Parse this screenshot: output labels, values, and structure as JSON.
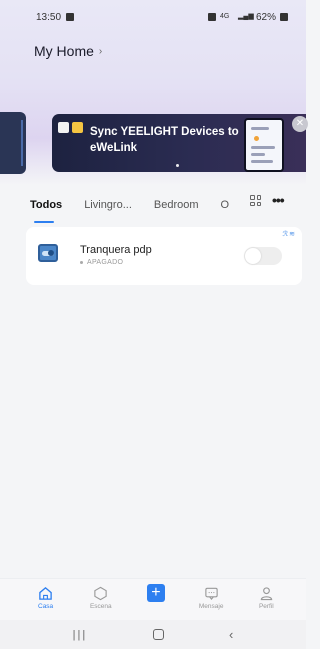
{
  "status_bar": {
    "time": "13:50",
    "battery": "62%",
    "network": "4G"
  },
  "home": {
    "title": "My Home"
  },
  "banner": {
    "text": "Sync YEELIGHT Devices to eWeLink"
  },
  "tabs": [
    {
      "label": "Todos",
      "active": true
    },
    {
      "label": "Livingro..."
    },
    {
      "label": "Bedroom"
    },
    {
      "label": "O"
    }
  ],
  "device": {
    "name": "Tranquera pdp",
    "status": "APAGADO"
  },
  "nav": [
    {
      "label": "Casa",
      "icon": "home-icon",
      "active": true
    },
    {
      "label": "Escena",
      "icon": "hexagon-icon"
    },
    {
      "label": "",
      "icon": "plus-icon"
    },
    {
      "label": "Mensaje",
      "icon": "message-icon"
    },
    {
      "label": "Perfil",
      "icon": "person-icon"
    }
  ],
  "colors": {
    "accent": "#2d7ff0",
    "banner": "#1d2240"
  }
}
